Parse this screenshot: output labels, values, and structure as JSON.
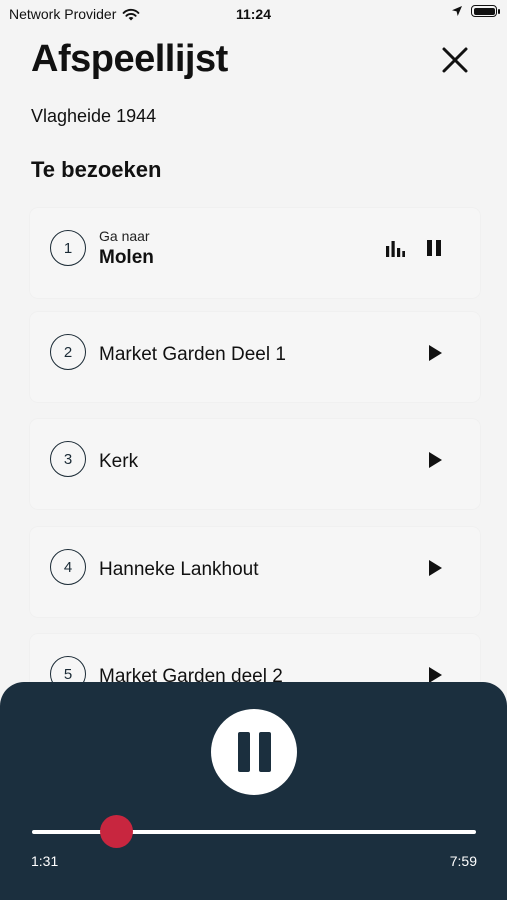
{
  "status_bar": {
    "carrier": "Network Provider",
    "time": "11:24"
  },
  "header": {
    "title": "Afspeellijst",
    "subtitle": "Vlagheide 1944"
  },
  "section": {
    "title": "Te bezoeken"
  },
  "items": [
    {
      "number": "1",
      "prefix": "Ga naar",
      "label": "Molen",
      "state": "playing"
    },
    {
      "number": "2",
      "label": "Market Garden Deel 1",
      "state": "idle"
    },
    {
      "number": "3",
      "label": "Kerk",
      "state": "idle"
    },
    {
      "number": "4",
      "label": "Hanneke Lankhout",
      "state": "idle"
    },
    {
      "number": "5",
      "label": "Market Garden deel 2",
      "state": "idle"
    }
  ],
  "player": {
    "current_time": "1:31",
    "total_time": "7:59",
    "progress": 0.19,
    "state": "playing",
    "accent": "#c8263f",
    "background": "#1b2f3e"
  },
  "icons": {
    "wifi": "wifi-icon",
    "location": "location-arrow-icon",
    "battery": "battery-icon",
    "close": "close-icon",
    "play": "play-icon",
    "pause": "pause-icon",
    "equalizer": "equalizer-icon"
  }
}
